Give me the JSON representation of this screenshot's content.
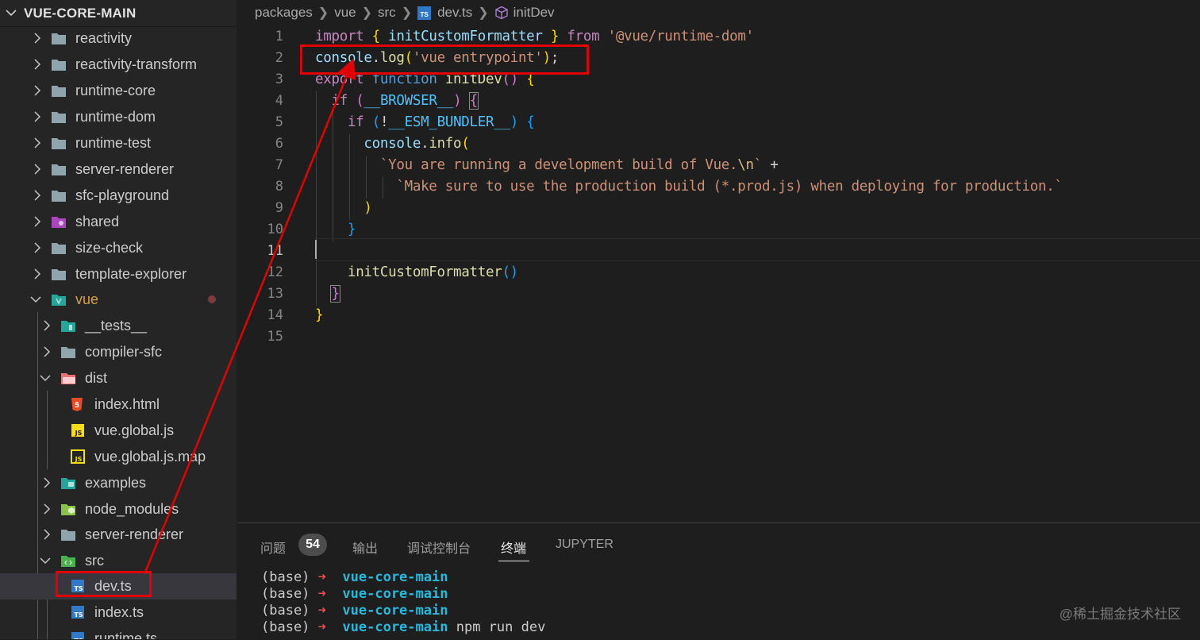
{
  "explorer": {
    "title": "VUE-CORE-MAIN",
    "items": [
      {
        "label": "reactivity",
        "type": "folder"
      },
      {
        "label": "reactivity-transform",
        "type": "folder"
      },
      {
        "label": "runtime-core",
        "type": "folder"
      },
      {
        "label": "runtime-dom",
        "type": "folder"
      },
      {
        "label": "runtime-test",
        "type": "folder"
      },
      {
        "label": "server-renderer",
        "type": "folder"
      },
      {
        "label": "sfc-playground",
        "type": "folder"
      },
      {
        "label": "shared",
        "type": "folder"
      },
      {
        "label": "size-check",
        "type": "folder"
      },
      {
        "label": "template-explorer",
        "type": "folder"
      },
      {
        "label": "vue",
        "type": "folder-open"
      },
      {
        "label": "__tests__",
        "type": "folder"
      },
      {
        "label": "compiler-sfc",
        "type": "folder"
      },
      {
        "label": "dist",
        "type": "folder-open"
      },
      {
        "label": "index.html",
        "type": "file"
      },
      {
        "label": "vue.global.js",
        "type": "file"
      },
      {
        "label": "vue.global.js.map",
        "type": "file"
      },
      {
        "label": "examples",
        "type": "folder"
      },
      {
        "label": "node_modules",
        "type": "folder"
      },
      {
        "label": "server-renderer",
        "type": "folder"
      },
      {
        "label": "src",
        "type": "folder-open"
      },
      {
        "label": "dev.ts",
        "type": "file"
      },
      {
        "label": "index.ts",
        "type": "file"
      },
      {
        "label": "runtime.ts",
        "type": "file"
      }
    ]
  },
  "breadcrumb": {
    "packages": "packages",
    "vue": "vue",
    "src": "src",
    "file": "dev.ts",
    "symbol": "initDev",
    "ts_badge": "TS"
  },
  "editor": {
    "line_numbers": [
      "1",
      "2",
      "3",
      "4",
      "5",
      "6",
      "7",
      "8",
      "9",
      "10",
      "11",
      "12",
      "13",
      "14",
      "15"
    ],
    "current_line": "11",
    "line1": {
      "import": "import",
      "ob": "{",
      "name": "initCustomFormatter",
      "cb": "}",
      "from": "from",
      "mod": "'@vue/runtime-dom'"
    },
    "line2": {
      "obj": "console",
      "dot": ".",
      "fn": "log",
      "op": "(",
      "str": "'vue entrypoint'",
      "cp": ")",
      "semi": ";"
    },
    "line3": {
      "export": "export",
      "function": "function",
      "name": "initDev",
      "parens": "()",
      "ob": "{"
    },
    "line4": {
      "if": "if",
      "op": "(",
      "flag": "__BROWSER__",
      "cp": ")",
      "ob": "{"
    },
    "line5": {
      "if": "if",
      "op": "(",
      "not": "!",
      "flag": "__ESM_BUNDLER__",
      "cp": ")",
      "ob": "{"
    },
    "line6": {
      "obj": "console",
      "dot": ".",
      "fn": "info",
      "op": "("
    },
    "line7": {
      "str_a": "`You are running a development build of Vue.",
      "esc": "\\n",
      "str_b": "`",
      "plus": "+"
    },
    "line8": {
      "str": "`Make sure to use the production build (*.prod.js) when deploying for production.`"
    },
    "line9": {
      "cp": ")"
    },
    "line10": {
      "cb": "}"
    },
    "line12": {
      "fn": "initCustomFormatter",
      "parens": "()"
    },
    "line13": {
      "cb": "}"
    },
    "line14": {
      "cb": "}"
    }
  },
  "panel": {
    "tabs": [
      {
        "label": "问题"
      },
      {
        "label": "输出"
      },
      {
        "label": "调试控制台"
      },
      {
        "label": "终端"
      },
      {
        "label": "JUPYTER"
      }
    ],
    "problems_count": "54",
    "active_tab": "终端",
    "terminal": [
      {
        "prefix": "(base)",
        "arrow": "➜",
        "dir": "vue-core-main",
        "cmd": ""
      },
      {
        "prefix": "(base)",
        "arrow": "➜",
        "dir": "vue-core-main",
        "cmd": ""
      },
      {
        "prefix": "(base)",
        "arrow": "➜",
        "dir": "vue-core-main",
        "cmd": ""
      },
      {
        "prefix": "(base)",
        "arrow": "➜",
        "dir": "vue-core-main",
        "cmd": "npm run dev"
      }
    ]
  },
  "watermark": "@稀土掘金技术社区",
  "colors": {
    "annotation": "#e00000",
    "keyword": "#c586c0",
    "string": "#ce9178",
    "function": "#dcdcaa",
    "terminal_dir": "#29b8db",
    "terminal_arrow": "#f14c4c"
  }
}
